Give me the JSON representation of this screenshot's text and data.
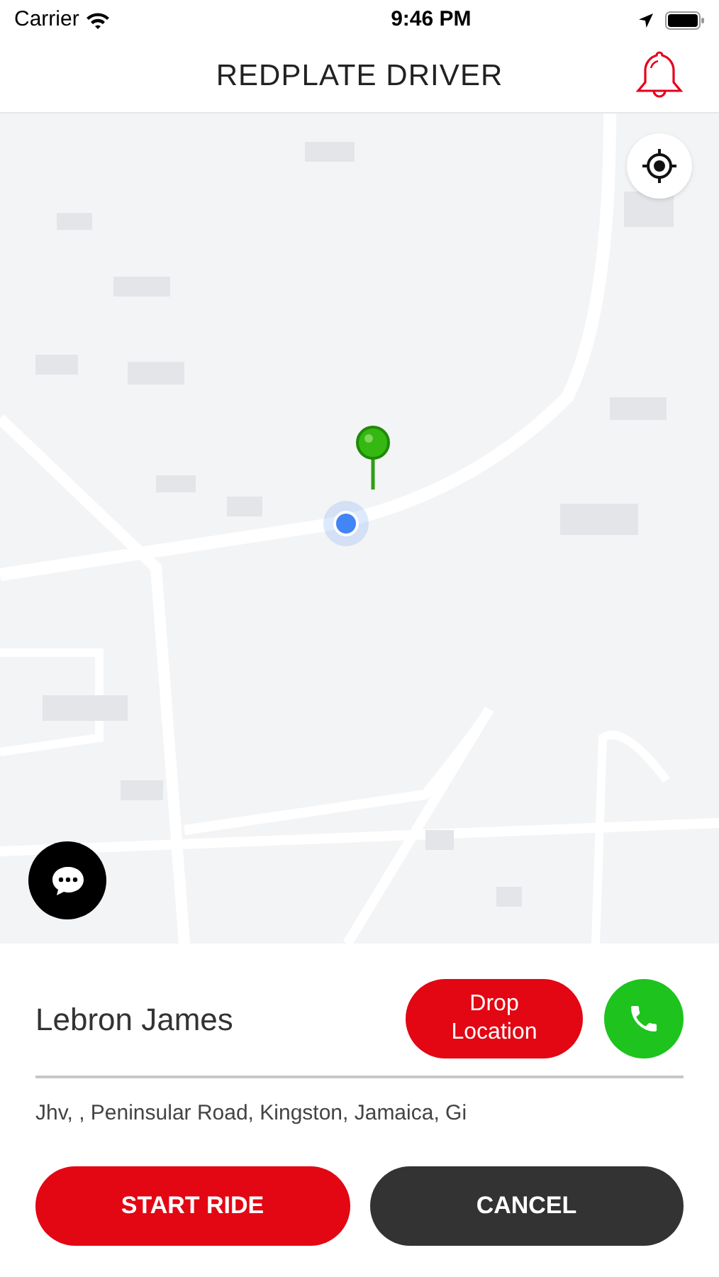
{
  "status_bar": {
    "carrier": "Carrier",
    "time": "9:46 PM"
  },
  "header": {
    "title": "REDPLATE DRIVER"
  },
  "ride": {
    "passenger": "Lebron James",
    "drop_button": "Drop Location",
    "address": "Jhv, , Peninsular Road, Kingston, Jamaica,  Gi"
  },
  "buttons": [
    {
      "label": "START RIDE",
      "kind": "primary"
    },
    {
      "label": "CANCEL",
      "kind": "secondary"
    }
  ]
}
